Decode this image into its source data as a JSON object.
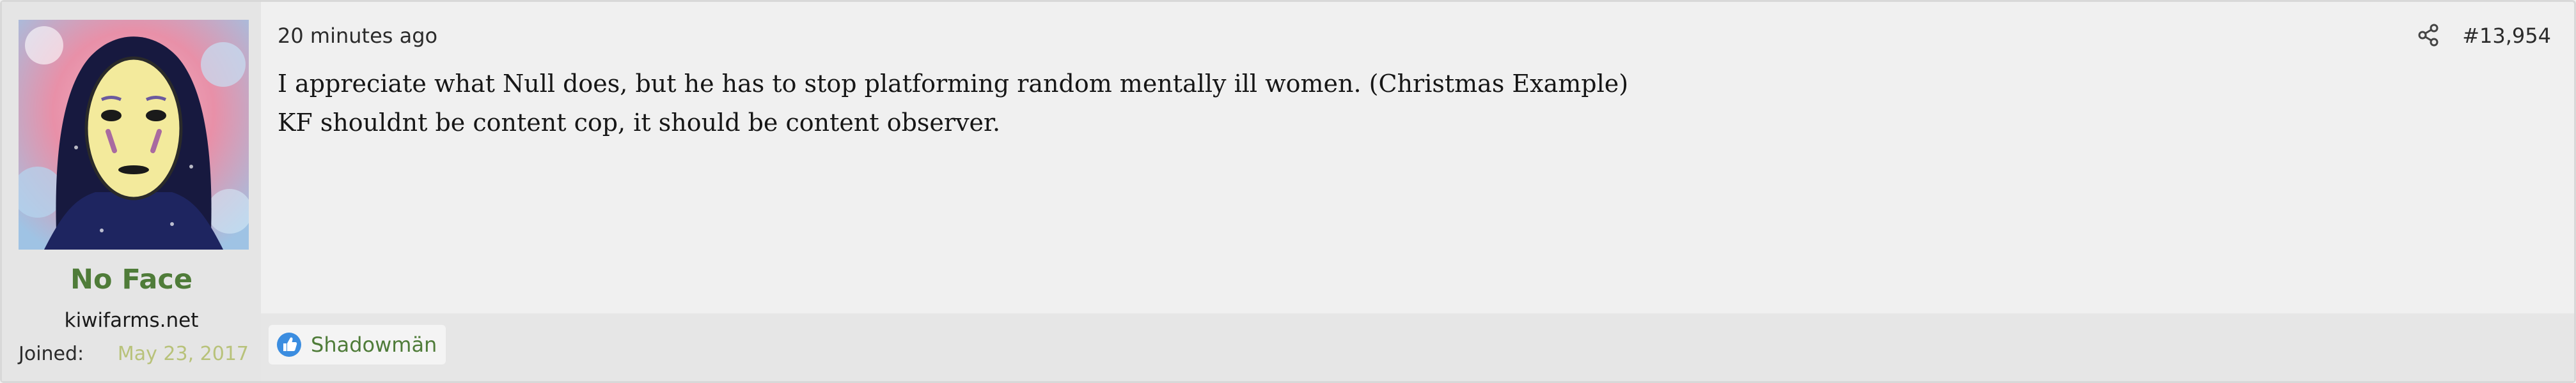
{
  "post": {
    "author": {
      "name": "No Face",
      "title": "kiwifarms.net",
      "joined_label": "Joined:",
      "joined_value": "May 23, 2017",
      "avatar_icon": "no-face-avatar"
    },
    "timestamp": "20 minutes ago",
    "number": "#13,954",
    "share_icon": "share-icon",
    "body_lines": [
      "I appreciate what Null does, but he has to stop platforming random mentally ill women. (Christmas Example)",
      "KF shouldnt be content cop, it should be content observer."
    ],
    "reactions": {
      "icon": "like-icon",
      "users": [
        "Shadowmän"
      ]
    }
  },
  "colors": {
    "username": "#4f7c39",
    "joined_value": "#b8c27a",
    "like_blue": "#3b8de0"
  }
}
